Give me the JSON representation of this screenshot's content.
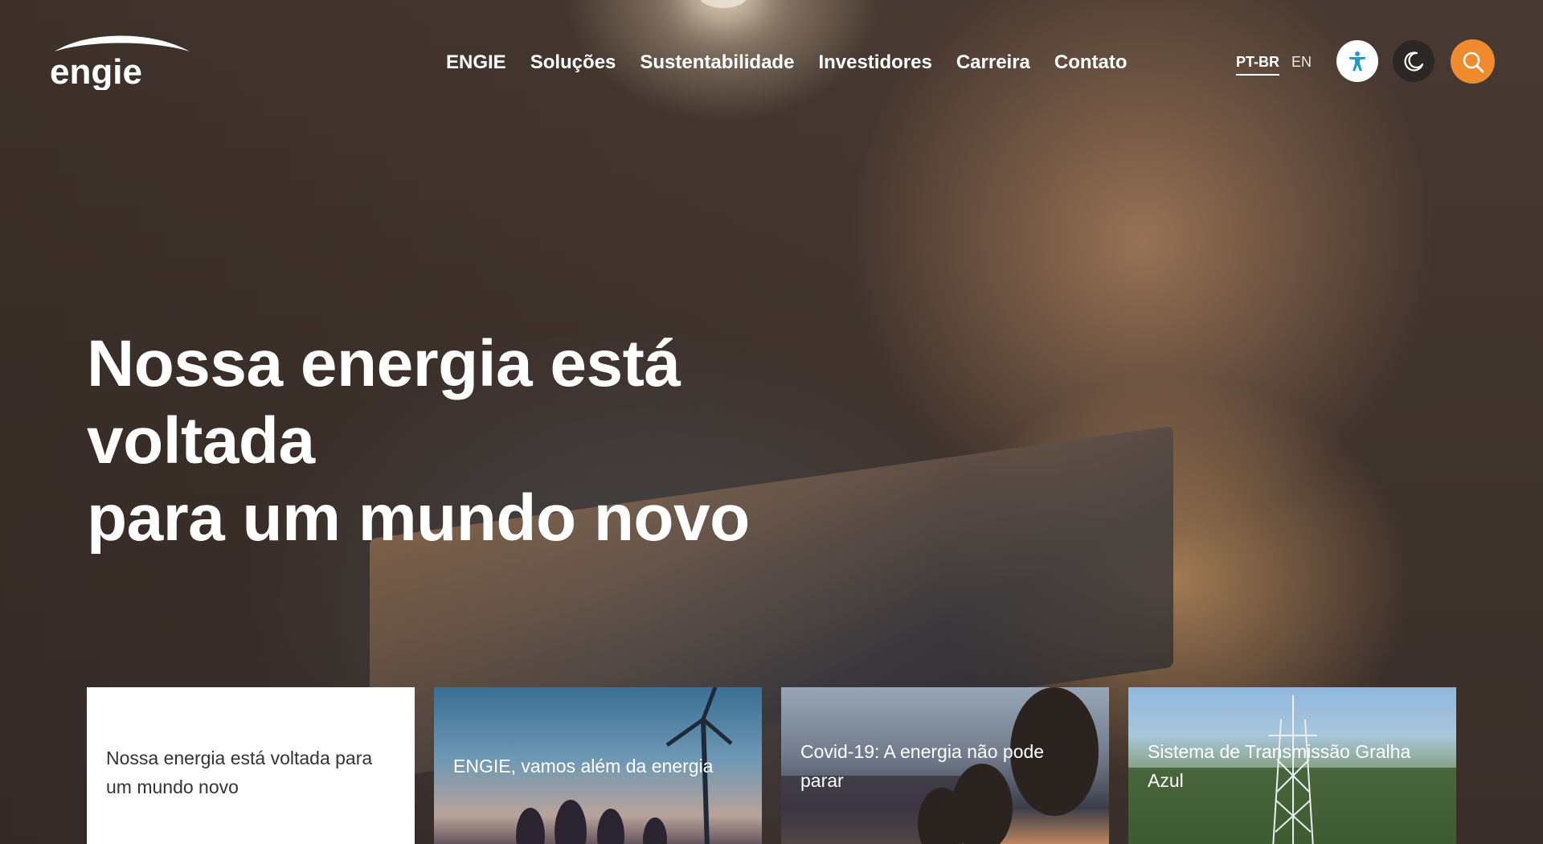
{
  "brand": {
    "logo_text": "engie",
    "accent_color": "#f08a2e"
  },
  "nav": {
    "items": [
      {
        "label": "ENGIE"
      },
      {
        "label": "Soluções"
      },
      {
        "label": "Sustentabilidade"
      },
      {
        "label": "Investidores"
      },
      {
        "label": "Carreira"
      },
      {
        "label": "Contato"
      }
    ]
  },
  "language": {
    "active": "PT-BR",
    "other": "EN"
  },
  "actions": {
    "accessibility_icon": "accessibility-icon",
    "dark_mode_icon": "moon-icon",
    "search_icon": "search-icon"
  },
  "hero": {
    "title_line1": "Nossa energia está voltada",
    "title_line2": "para um mundo novo"
  },
  "cards": [
    {
      "title": "Nossa energia está voltada para um mundo novo"
    },
    {
      "title": "ENGIE, vamos além da energia"
    },
    {
      "title": "Covid-19: A energia não pode parar"
    },
    {
      "title": "Sistema de Transmissão Gralha Azul"
    }
  ]
}
